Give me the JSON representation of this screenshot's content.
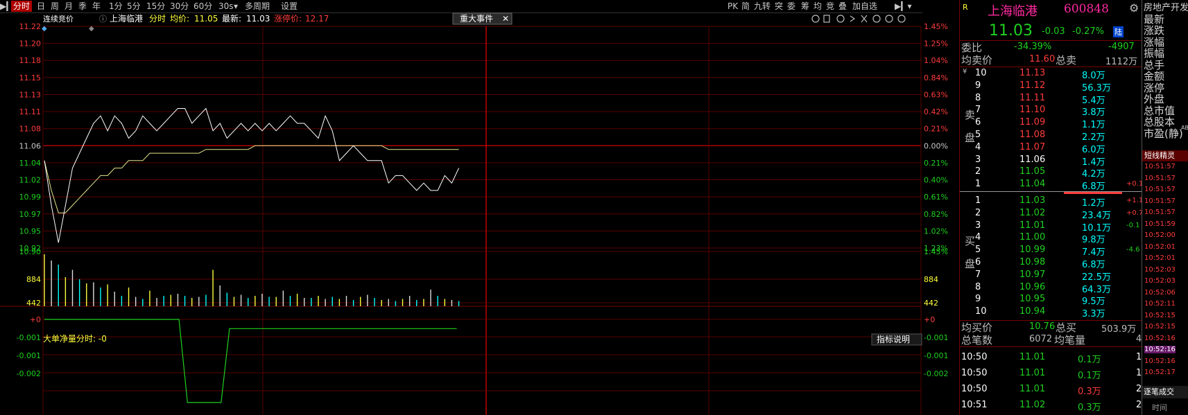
{
  "toolbar": {
    "tabs": [
      "分时",
      "日",
      "周",
      "月",
      "季",
      "年",
      "1分",
      "5分",
      "15分",
      "30分",
      "60分",
      "30s",
      "多周期",
      "设置"
    ],
    "right_tabs": [
      "PK",
      "简",
      "九转",
      "突",
      "委",
      "筹",
      "均",
      "竞",
      "叠",
      "加自选"
    ]
  },
  "header": {
    "auction_label": "连续竞价",
    "stock_name": "上海临港",
    "mode": "分时",
    "avg_label": "均价:",
    "avg_value": "11.05",
    "latest_label": "最新:",
    "latest_value": "11.03",
    "limit_label": "涨停价:",
    "limit_value": "12.17",
    "event_button": "重大事件"
  },
  "chart": {
    "price_labels": [
      "11.22",
      "11.20",
      "11.18",
      "11.15",
      "11.13",
      "11.11",
      "11.08",
      "11.06",
      "11.04",
      "11.02",
      "10.99",
      "10.97",
      "10.95",
      "10.92",
      "10.90"
    ],
    "pct_labels": [
      "1.45%",
      "1.25%",
      "1.04%",
      "0.84%",
      "0.63%",
      "0.42%",
      "0.21%",
      "0.00%",
      "0.21%",
      "0.40%",
      "0.61%",
      "0.82%",
      "1.02%",
      "1.23%",
      "1.45%"
    ],
    "volume_labels": [
      "884",
      "442"
    ],
    "indicator_title": "大单净量分时: -0",
    "indicator_button": "指标说明",
    "indicator_labels": [
      "+0",
      "-0.001",
      "-0.001",
      "-0.002"
    ]
  },
  "chart_data": {
    "type": "line",
    "title": "上海临港 分时",
    "prev_close": 11.06,
    "ylim": [
      10.9,
      11.22
    ],
    "series": [
      {
        "name": "最新",
        "values": [
          11.04,
          10.98,
          10.93,
          10.98,
          11.03,
          11.05,
          11.07,
          11.09,
          11.1,
          11.08,
          11.1,
          11.09,
          11.07,
          11.08,
          11.1,
          11.09,
          11.08,
          11.09,
          11.1,
          11.11,
          11.11,
          11.09,
          11.1,
          11.11,
          11.08,
          11.09,
          11.07,
          11.08,
          11.09,
          11.08,
          11.09,
          11.08,
          11.09,
          11.08,
          11.09,
          11.1,
          11.09,
          11.09,
          11.08,
          11.07,
          11.1,
          11.08,
          11.04,
          11.05,
          11.06,
          11.05,
          11.04,
          11.04,
          11.04,
          11.01,
          11.02,
          11.02,
          11.01,
          11.0,
          11.01,
          11.0,
          11.0,
          11.02,
          11.01,
          11.03
        ]
      },
      {
        "name": "均价",
        "values": [
          11.04,
          11.0,
          10.97,
          10.97,
          10.98,
          10.99,
          11.0,
          11.01,
          11.02,
          11.02,
          11.03,
          11.03,
          11.04,
          11.04,
          11.04,
          11.05,
          11.05,
          11.05,
          11.05,
          11.05,
          11.05,
          11.05,
          11.05,
          11.055,
          11.055,
          11.055,
          11.055,
          11.055,
          11.055,
          11.055,
          11.06,
          11.06,
          11.06,
          11.06,
          11.06,
          11.06,
          11.06,
          11.06,
          11.06,
          11.06,
          11.06,
          11.06,
          11.06,
          11.06,
          11.06,
          11.06,
          11.06,
          11.06,
          11.06,
          11.055,
          11.055,
          11.055,
          11.055,
          11.055,
          11.055,
          11.055,
          11.055,
          11.055,
          11.055,
          11.055
        ]
      }
    ],
    "volume": [
      1000,
      880,
      800,
      560,
      700,
      520,
      440,
      460,
      360,
      420,
      280,
      200,
      360,
      180,
      140,
      300,
      160,
      200,
      220,
      240,
      200,
      160,
      180,
      220,
      700,
      400,
      260,
      180,
      220,
      160,
      200,
      240,
      180,
      180,
      300,
      200,
      240,
      160,
      160,
      200,
      140,
      180,
      140,
      200,
      120,
      180,
      220,
      160,
      120,
      140,
      100,
      140,
      200,
      120,
      140,
      320,
      200,
      140,
      120,
      100
    ],
    "indicator": {
      "name": "大单净量分时",
      "values": [
        0,
        0,
        0,
        0,
        0,
        0,
        0,
        0,
        0,
        0,
        0,
        0,
        0,
        0,
        0,
        0,
        0,
        -0.0045,
        -0.0045,
        -0.0045,
        -0.0045,
        -0.0045,
        -0.0005,
        -0.0005,
        -0.0005,
        -0.0005,
        -0.0005,
        -0.0005,
        -0.0005,
        -0.0005,
        -0.0005,
        -0.0005,
        -0.0005,
        -0.0005,
        -0.0005,
        -0.0005,
        -0.0005,
        -0.0005,
        -0.0005,
        -0.0005,
        -0.0005,
        -0.0005,
        -0.0005,
        -0.0005,
        -0.0005,
        -0.0005,
        -0.0005,
        -0.0005,
        -0.0005,
        -0.0005
      ]
    }
  },
  "panel": {
    "name": "上海临港",
    "code": "600848",
    "price": "11.03",
    "change": "-0.03",
    "change_pct": "-0.27%",
    "tag": "陆",
    "weibi_label": "委比",
    "weibi_value": "-34.39%",
    "weicha_value": "-4907",
    "avg_sell_label": "均卖价",
    "avg_sell_value": "11.60",
    "total_sell_label": "总卖",
    "total_sell_value": "1112万",
    "sell_side_label": "卖盘",
    "buy_side_label": "买盘",
    "sells": [
      {
        "level": "10",
        "price": "11.13",
        "vol": "8.0万",
        "chg": ""
      },
      {
        "level": "9",
        "price": "11.12",
        "vol": "56.3万",
        "chg": ""
      },
      {
        "level": "8",
        "price": "11.11",
        "vol": "5.4万",
        "chg": ""
      },
      {
        "level": "7",
        "price": "11.10",
        "vol": "3.8万",
        "chg": ""
      },
      {
        "level": "6",
        "price": "11.09",
        "vol": "1.1万",
        "chg": ""
      },
      {
        "level": "5",
        "price": "11.08",
        "vol": "2.2万",
        "chg": ""
      },
      {
        "level": "4",
        "price": "11.07",
        "vol": "6.0万",
        "chg": ""
      },
      {
        "level": "3",
        "price": "11.06",
        "vol": "1.4万",
        "chg": ""
      },
      {
        "level": "2",
        "price": "11.05",
        "vol": "4.2万",
        "chg": ""
      },
      {
        "level": "1",
        "price": "11.04",
        "vol": "6.8万",
        "chg": "+0.1"
      }
    ],
    "buys": [
      {
        "level": "1",
        "price": "11.03",
        "vol": "1.2万",
        "chg": "+1.1"
      },
      {
        "level": "2",
        "price": "11.02",
        "vol": "23.4万",
        "chg": "+0.7"
      },
      {
        "level": "3",
        "price": "11.01",
        "vol": "10.1万",
        "chg": "-0.1"
      },
      {
        "level": "4",
        "price": "11.00",
        "vol": "9.8万",
        "chg": ""
      },
      {
        "level": "5",
        "price": "10.99",
        "vol": "7.4万",
        "chg": "-4.6"
      },
      {
        "level": "6",
        "price": "10.98",
        "vol": "6.8万",
        "chg": ""
      },
      {
        "level": "7",
        "price": "10.97",
        "vol": "22.5万",
        "chg": ""
      },
      {
        "level": "8",
        "price": "10.96",
        "vol": "64.3万",
        "chg": ""
      },
      {
        "level": "9",
        "price": "10.95",
        "vol": "9.5万",
        "chg": ""
      },
      {
        "level": "10",
        "price": "10.94",
        "vol": "3.3万",
        "chg": ""
      }
    ],
    "avg_buy_label": "均买价",
    "avg_buy_value": "10.76",
    "total_buy_label": "总买",
    "total_buy_value": "503.9万",
    "total_trades_label": "总笔数",
    "total_trades_value": "6072",
    "avg_trade_label": "均笔量",
    "avg_trade_value": "4",
    "trades": [
      {
        "time": "10:50",
        "price": "11.01",
        "vol": "0.1万",
        "n": "1"
      },
      {
        "time": "10:50",
        "price": "11.01",
        "vol": "0.1万",
        "n": "1"
      },
      {
        "time": "10:50",
        "price": "11.01",
        "vol": "0.3万",
        "n": "2"
      },
      {
        "time": "10:51",
        "price": "11.02",
        "vol": "0.3万",
        "n": "2"
      }
    ]
  },
  "info": {
    "items": [
      "房地产开发",
      "最新",
      "涨跌",
      "涨幅",
      "振幅",
      "总手",
      "金额",
      "涨停",
      "外盘",
      "总市值",
      "总股本",
      "市盈(静)"
    ],
    "ab_label": "AB",
    "short_title": "短线精灵",
    "times": [
      "10:51:57",
      "10:51:57",
      "10:51:57",
      "10:51:57",
      "10:51:57",
      "10:51:59",
      "10:52:00",
      "10:52:01",
      "10:52:01",
      "10:52:03",
      "10:52:03",
      "10:52:06",
      "10:52:11",
      "10:52:15",
      "10:52:15",
      "10:52:16",
      "10:52:16",
      "10:52:16",
      "10:52:17"
    ],
    "deal_label": "逐笔成交",
    "time_label": "时间"
  }
}
